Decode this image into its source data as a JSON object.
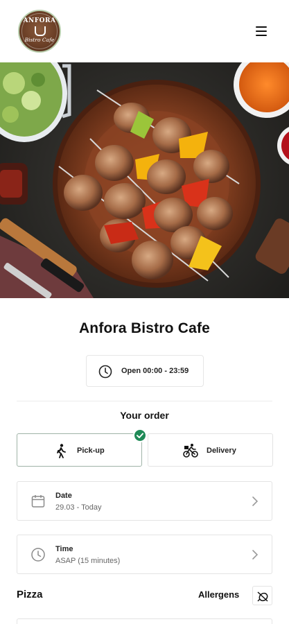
{
  "header": {
    "logo_top": "ANFORA",
    "logo_bottom": "Bistro Cafe",
    "menu_icon": "hamburger-menu-icon"
  },
  "hero": {
    "description_icon": "food-photo"
  },
  "restaurant": {
    "name": "Anfora Bistro Cafe",
    "hours": "Open 00:00 - 23:59"
  },
  "order": {
    "heading": "Your order",
    "options": [
      {
        "label": "Pick-up",
        "icon": "walking-person-icon",
        "selected": true
      },
      {
        "label": "Delivery",
        "icon": "bicycle-courier-icon",
        "selected": false
      }
    ],
    "date": {
      "label": "Date",
      "value": "29.03 - Today",
      "icon": "calendar-icon"
    },
    "time": {
      "label": "Time",
      "value": "ASAP (15 minutes)",
      "icon": "clock-icon"
    }
  },
  "menu_section": {
    "category": "Pizza",
    "allergens_label": "Allergens",
    "allergens_icon": "no-allergen-icon"
  },
  "colors": {
    "accent": "#1f8a57",
    "selected_border": "#9fb3a7",
    "border": "#e3e3e3"
  }
}
